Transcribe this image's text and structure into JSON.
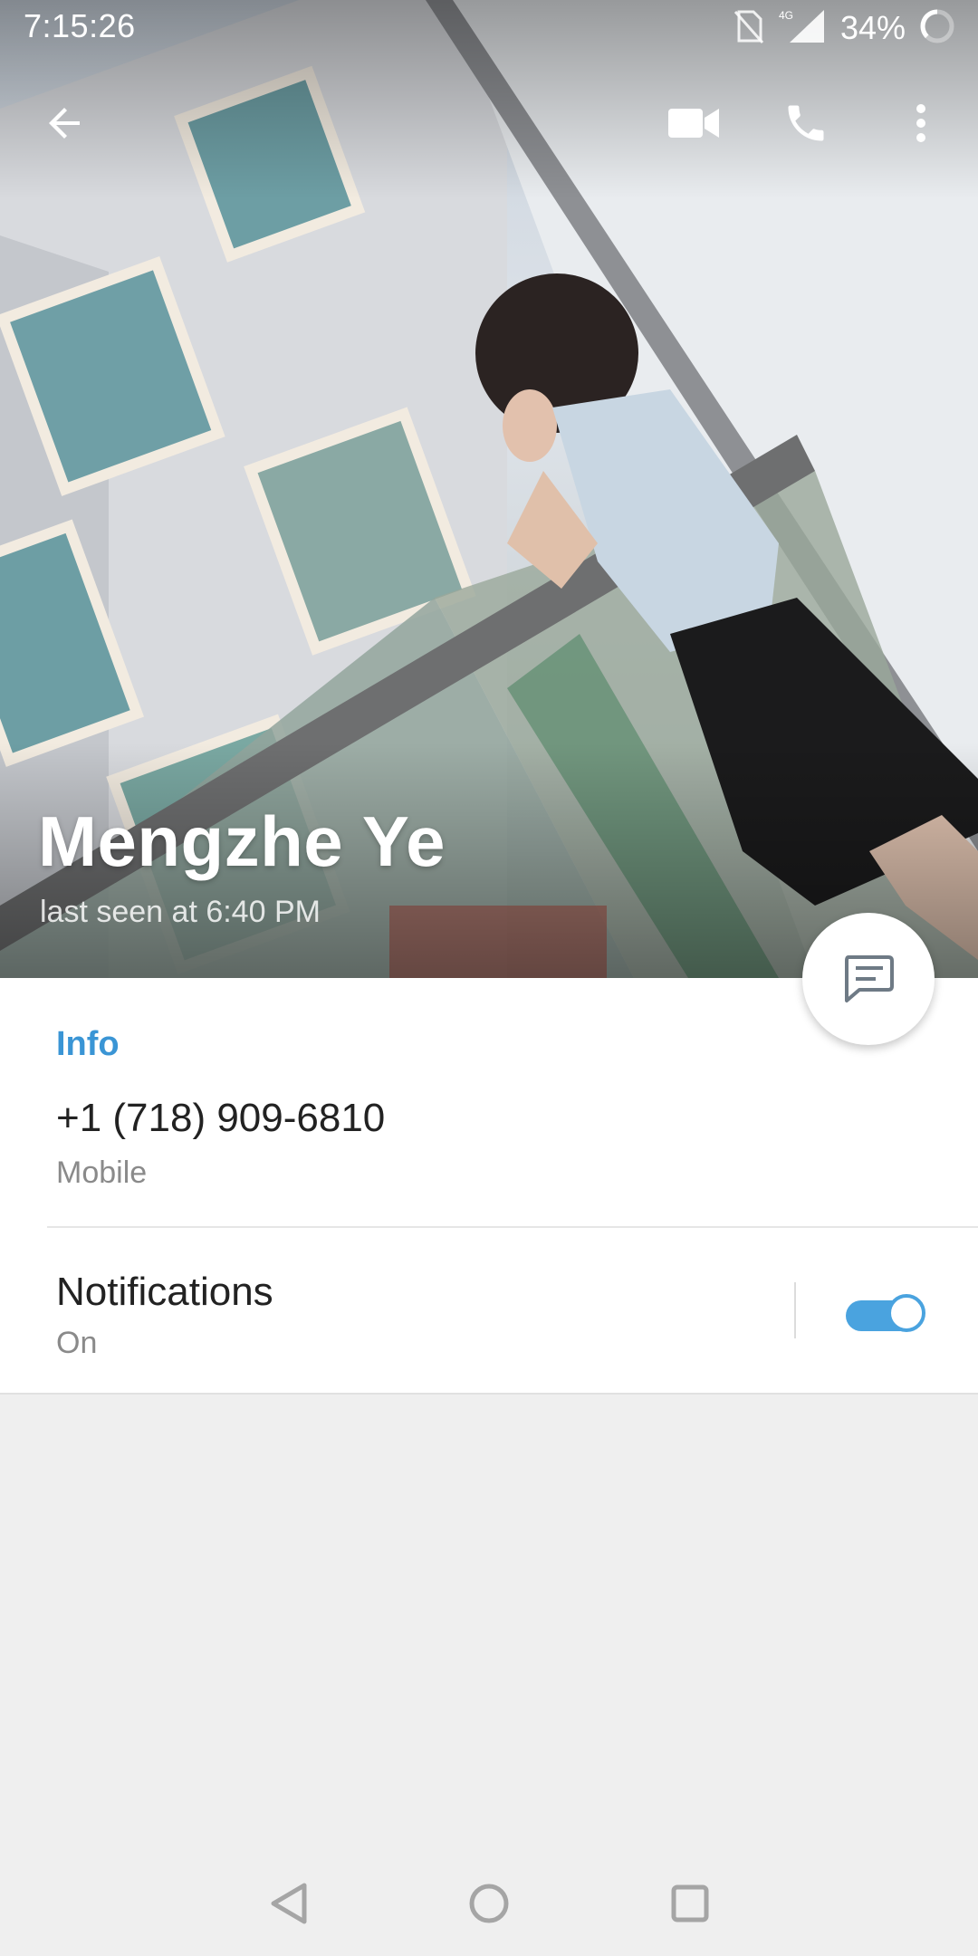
{
  "status_bar": {
    "time": "7:15:26",
    "network": "4G",
    "battery": "34%"
  },
  "app_bar": {
    "icons": [
      "back-arrow-icon",
      "video-camera-icon",
      "phone-icon",
      "more-vert-icon"
    ]
  },
  "profile": {
    "name": "Mengzhe Ye",
    "status": "last seen at 6:40 PM"
  },
  "info": {
    "section_title": "Info",
    "phone_number": "+1 (718) 909-6810",
    "phone_label": "Mobile"
  },
  "notifications": {
    "label": "Notifications",
    "value": "On",
    "enabled": true
  },
  "colors": {
    "accent": "#3a95d5",
    "toggle": "#4aa3df",
    "background": "#efefef"
  },
  "nav_bar": {
    "icons": [
      "nav-back-icon",
      "nav-home-icon",
      "nav-recents-icon"
    ]
  }
}
